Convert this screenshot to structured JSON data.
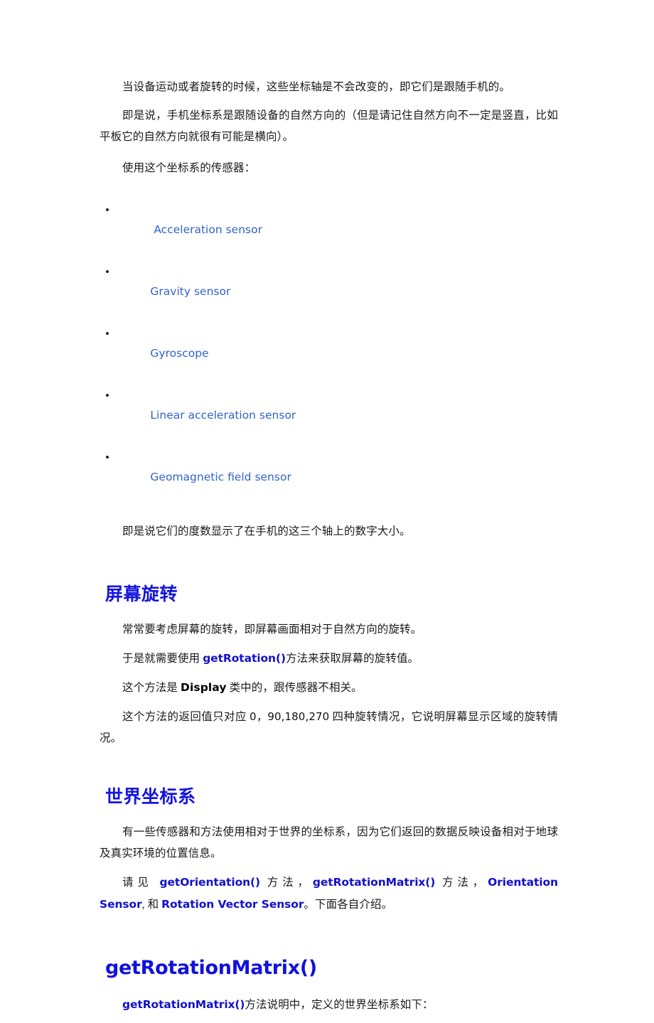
{
  "document": {
    "colors": {
      "heading_blue": "#1414e0",
      "code_blue": "#1111cc",
      "link_blue": "#3263cc",
      "body_black": "#1a1a1a",
      "page_background": "#ffffff"
    },
    "blocks": {
      "p_axes_fixed": "当设备运动或者旋转的时候，这些坐标轴是不会改变的，即它们是跟随手机的。",
      "p_natural_direction": "即是说，手机坐标系是跟随设备的自然方向的（但是请记住自然方向不一定是竖直，比如平板它的自然方向就很有可能是横向）。",
      "p_sensors_intro": "使用这个坐标系的传感器：",
      "p_degrees_note": "即是说它们的度数显示了在手机的这三个轴上的数字大小。",
      "p_screen_rotation_1": "常常要考虑屏幕的旋转，即屏幕画面相对于自然方向的旋转。",
      "p_get_rotation_prefix": "于是就需要使用 ",
      "p_get_rotation_code": "getRotation()",
      "p_get_rotation_suffix": "方法来获取屏幕的旋转值。",
      "p_display_prefix": "这个方法是 ",
      "p_display_code": "Display",
      "p_display_suffix": " 类中的，跟传感器不相关。",
      "p_return_values_prefix": "这个方法的返回值只对应 ",
      "p_return_values_numbers": "0，90,180,270",
      "p_return_values_suffix": " 四种旋转情况，它说明屏幕显示区域的旋转情况。",
      "p_world_coords": "有一些传感器和方法使用相对于世界的坐标系，因为它们返回的数据反映设备相对于地球及真实环境的位置信息。",
      "p_see_also_prefix": "请见 ",
      "p_see_also_link1": "getOrientation()",
      "p_see_also_mid1": " 方法，",
      "p_see_also_link2": "getRotationMatrix()",
      "p_see_also_mid2": " 方法，",
      "p_see_also_link3": "Orientation Sensor",
      "p_see_also_mid3": ", 和 ",
      "p_see_also_link4": "Rotation Vector Sensor",
      "p_see_also_suffix": "。下面各自介绍。",
      "p_matrix_desc_code": "getRotationMatrix()",
      "p_matrix_desc_suffix": "方法说明中，定义的世界坐标系如下："
    },
    "headings": {
      "screen_rotation": "屏幕旋转",
      "world_coordinate_system": "世界坐标系",
      "get_rotation_matrix": "getRotationMatrix()"
    },
    "sensor_list": [
      {
        "label": " Acceleration sensor"
      },
      {
        "label": "Gravity sensor"
      },
      {
        "label": "Gyroscope"
      },
      {
        "label": "Linear acceleration sensor"
      },
      {
        "label": "Geomagnetic field sensor"
      }
    ]
  }
}
